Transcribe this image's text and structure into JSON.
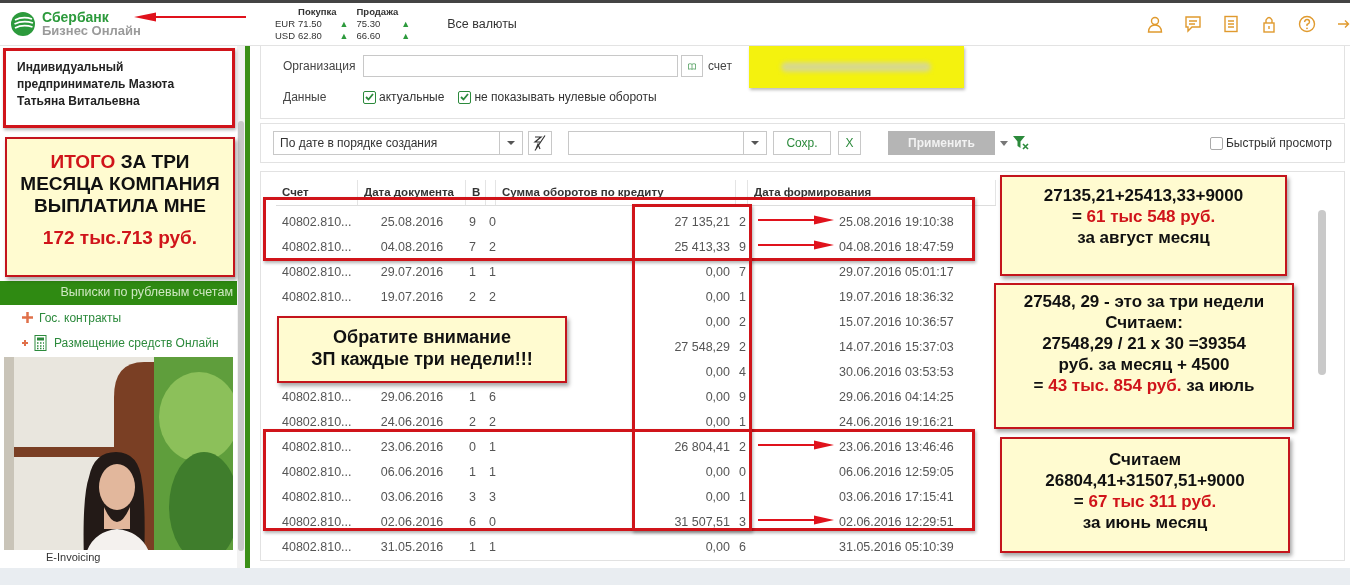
{
  "header": {
    "brand": "Сбербанк",
    "subtitle": "Бизнес Онлайн",
    "rate_heads": [
      "Покупка",
      "Продажа"
    ],
    "rates": [
      {
        "currency": "EUR",
        "buy": "71.50",
        "buy_trend": "▲",
        "sell": "75.30",
        "sell_trend": "▲"
      },
      {
        "currency": "USD",
        "buy": "62.80",
        "buy_trend": "▲",
        "sell": "66.60",
        "sell_trend": "▲"
      }
    ],
    "all_rates_link": "Все валюты"
  },
  "sidebar": {
    "company": "Индивидуальный предприниматель Мазюта Татьяна Витальевна",
    "section": "Выписки по рублевым счетам",
    "items": [
      {
        "label": "Гос. контракты",
        "kind": "plus"
      },
      {
        "label": "Размещение средств Онлайн",
        "kind": "calculator"
      }
    ],
    "footer_link": "E-Invoicing"
  },
  "filters": {
    "organization_label": "Организация",
    "account_label": "счет",
    "data_label": "Данные",
    "checkboxes": [
      {
        "label": "актуальные",
        "checked": true
      },
      {
        "label": "не показывать нулевые обороты",
        "checked": true
      }
    ]
  },
  "toolbar": {
    "sort_select": "По дате в порядке создания",
    "save_button": "Сохр.",
    "clear_button": "X",
    "apply_button": {
      "label": "Применить",
      "disabled": true
    },
    "quick_view": {
      "label": "Быстрый просмотр",
      "checked": false
    }
  },
  "table": {
    "columns": {
      "account": "Счет",
      "doc_date": "Дата документа",
      "column_3": "В",
      "credit": "Сумма оборотов по кредиту",
      "formed": "Дата формирования"
    },
    "rows": [
      {
        "account": "40802.810...",
        "doc_date": "25.08.2016",
        "column_3": "9",
        "column_4": "0",
        "credit": "27 135,21",
        "column_6": "2",
        "formed": "25.08.2016 19:10:38",
        "arrow": true
      },
      {
        "account": "40802.810...",
        "doc_date": "04.08.2016",
        "column_3": "7",
        "column_4": "2",
        "credit": "25 413,33",
        "column_6": "9",
        "formed": "04.08.2016 18:47:59",
        "arrow": true
      },
      {
        "account": "40802.810...",
        "doc_date": "29.07.2016",
        "column_3": "1",
        "column_4": "1",
        "credit": "0,00",
        "column_6": "7",
        "formed": "29.07.2016 05:01:17",
        "arrow": false
      },
      {
        "account": "40802.810...",
        "doc_date": "19.07.2016",
        "column_3": "2",
        "column_4": "2",
        "credit": "0,00",
        "column_6": "1",
        "formed": "19.07.2016 18:36:32",
        "arrow": false
      },
      {
        "credit": "0,00",
        "column_6": "2",
        "formed": "15.07.2016 10:36:57",
        "arrow": false
      },
      {
        "credit": "27 548,29",
        "column_6": "2",
        "formed": "14.07.2016 15:37:03",
        "arrow": false
      },
      {
        "credit": "0,00",
        "column_6": "4",
        "formed": "30.06.2016 03:53:53",
        "arrow": false
      },
      {
        "account": "40802.810...",
        "doc_date": "29.06.2016",
        "column_3": "1",
        "column_4": "6",
        "credit": "0,00",
        "column_6": "9",
        "formed": "29.06.2016 04:14:25",
        "arrow": false
      },
      {
        "account": "40802.810...",
        "doc_date": "24.06.2016",
        "column_3": "2",
        "column_4": "2",
        "credit": "0,00",
        "column_6": "1",
        "formed": "24.06.2016 19:16:21",
        "arrow": false
      },
      {
        "account": "40802.810...",
        "doc_date": "23.06.2016",
        "column_3": "0",
        "column_4": "1",
        "credit": "26 804,41",
        "column_6": "2",
        "formed": "23.06.2016 13:46:46",
        "arrow": true
      },
      {
        "account": "40802.810...",
        "doc_date": "06.06.2016",
        "column_3": "1",
        "column_4": "1",
        "credit": "0,00",
        "column_6": "0",
        "formed": "06.06.2016 12:59:05",
        "arrow": false
      },
      {
        "account": "40802.810...",
        "doc_date": "03.06.2016",
        "column_3": "3",
        "column_4": "3",
        "credit": "0,00",
        "column_6": "1",
        "formed": "03.06.2016 17:15:41",
        "arrow": false
      },
      {
        "account": "40802.810...",
        "doc_date": "02.06.2016",
        "column_3": "6",
        "column_4": "0",
        "credit": "31 507,51",
        "column_6": "3",
        "formed": "02.06.2016 12:29:51",
        "arrow": true
      },
      {
        "account": "40802.810...",
        "doc_date": "31.05.2016",
        "column_3": "1",
        "column_4": "1",
        "credit": "0,00",
        "column_6": "6",
        "formed": "31.05.2016 05:10:39",
        "arrow": false
      }
    ]
  },
  "annotations": [
    {
      "lines": [
        "**ИТОГО** ЗА ТРИ",
        "МЕСЯЦА КОМПАНИЯ",
        "ВЫПЛАТИЛА МНЕ",
        "**172 тыс.713 руб.**"
      ]
    },
    {
      "lines": [
        "Обратите внимание",
        "ЗП каждые три недели!!!"
      ]
    },
    {
      "lines": [
        "27135,21+25413,33+9000",
        "= **61 тыс 548 руб.**",
        "за август месяц"
      ]
    },
    {
      "lines": [
        "27548, 29 - это за три недели",
        "Считаем:",
        "27548,29 / 21 х 30 =39354",
        "руб. за месяц + 4500",
        "= **43 тыс. 854 руб.** за июль"
      ]
    },
    {
      "lines": [
        "Считаем",
        "26804,41+31507,51+9000",
        "= **67 тыс 311 руб.**",
        "за июнь месяц"
      ]
    }
  ]
}
